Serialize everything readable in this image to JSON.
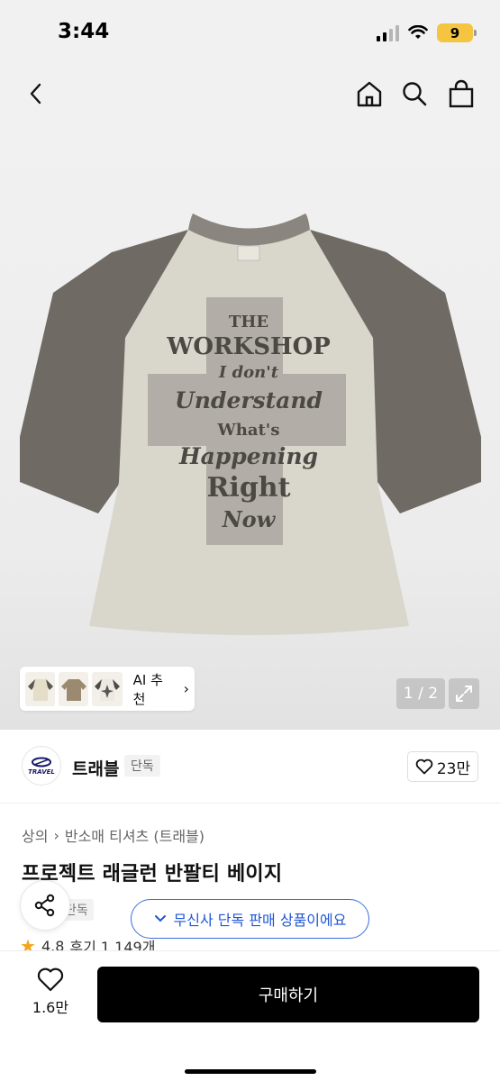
{
  "status_bar": {
    "time": "3:44",
    "battery": "9"
  },
  "gallery": {
    "ai_recommend_label": "AI 추천",
    "counter": "1 / 2",
    "shirt_print_lines": [
      "THE",
      "WORKSHOP",
      "I don't",
      "Understand",
      "What's",
      "Happening",
      "Right",
      "Now"
    ]
  },
  "brand": {
    "logo_text": "TRAVEL",
    "name": "트래블",
    "tag": "단독",
    "like_count": "23만"
  },
  "product": {
    "breadcrumb": [
      "상의",
      "반소매 티셔츠 (트래블)"
    ],
    "title": "프로젝트 래글런 반팔티 베이지",
    "exclusive_tag": "단독",
    "musinsa_badge": "무신사 단독 판매 상품이에요",
    "rating": "4.8",
    "reviews": "후기 1,149개"
  },
  "bottom_bar": {
    "wish_count": "1.6만",
    "buy_label": "구매하기"
  },
  "colors": {
    "accent_blue": "#1f56d6",
    "star": "#f3a51c",
    "buy_bg": "#000000",
    "sleeve": "#6f6a64",
    "body": "#d9d6cc"
  }
}
